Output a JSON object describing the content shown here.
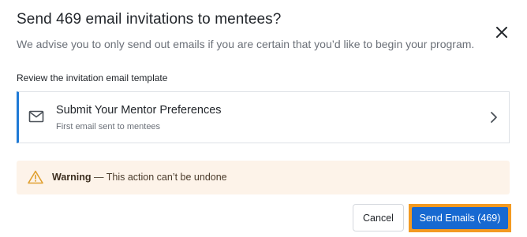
{
  "dialog": {
    "title": "Send 469 email invitations to mentees?",
    "subtitle": "We advise you to only send out emails if you are certain that you’d like to begin your program.",
    "close_icon": "close-icon"
  },
  "template_section": {
    "label": "Review the invitation email template",
    "card": {
      "icon": "mail-icon",
      "title": "Submit Your Mentor Preferences",
      "subtitle": "First email sent to mentees",
      "chevron_icon": "chevron-right-icon"
    }
  },
  "warning": {
    "icon": "warning-icon",
    "label": "Warning",
    "message": " — This action can’t be undone"
  },
  "actions": {
    "cancel_label": "Cancel",
    "send_label": "Send Emails (469)"
  },
  "colors": {
    "accent": "#1769d1",
    "focus_ring": "#f39a22",
    "warning_bg": "#fdf3e9",
    "warning_icon": "#e0a030",
    "card_left_border": "#1f7ad6"
  }
}
